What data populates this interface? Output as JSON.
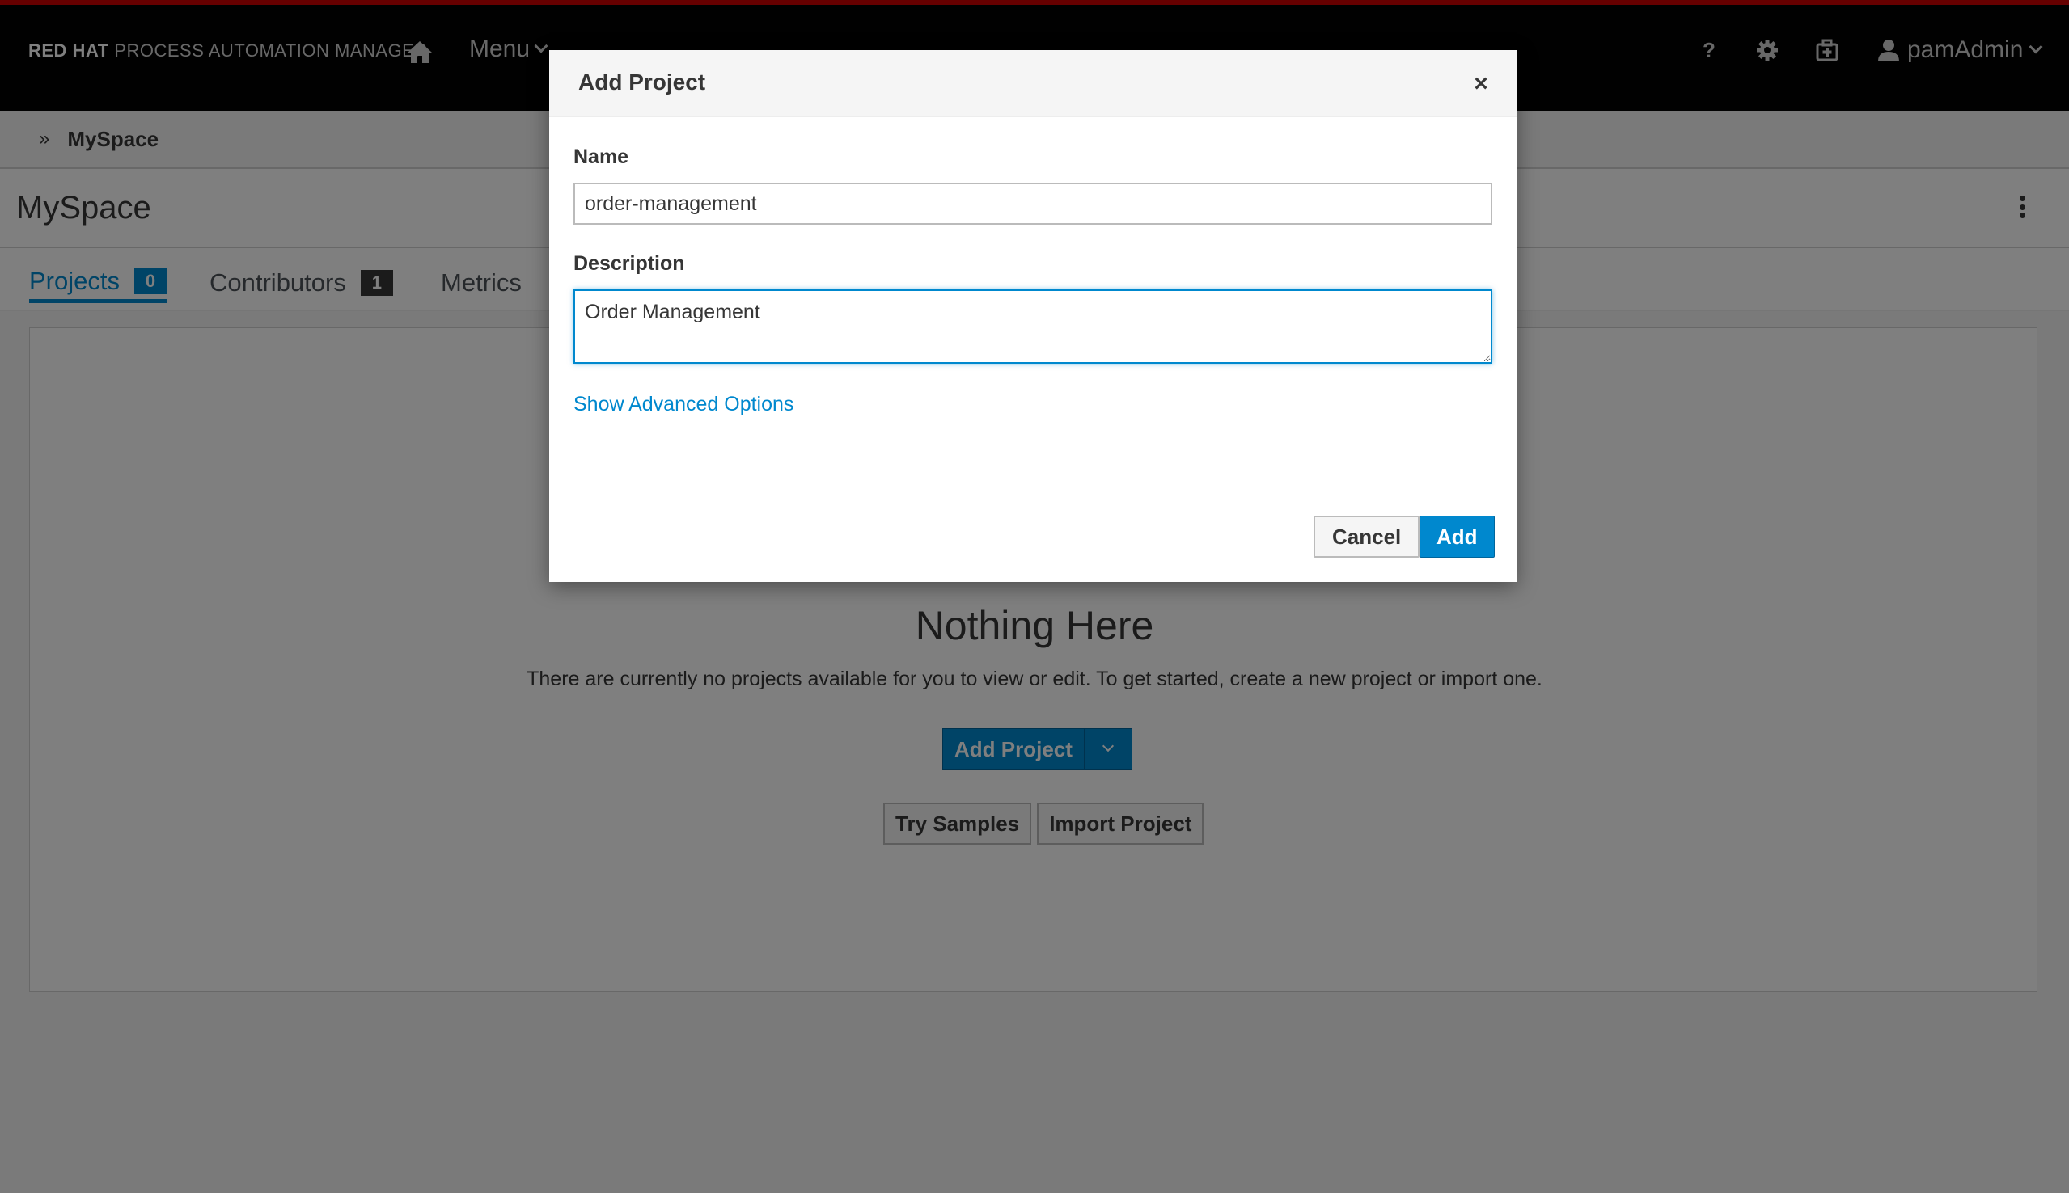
{
  "app": {
    "brand_bold": "RED HAT",
    "brand_rest": "PROCESS AUTOMATION MANAGER"
  },
  "nav": {
    "menu_label": "Menu",
    "help_label": "?",
    "user_label": "pamAdmin"
  },
  "breadcrumb": {
    "chevrons": "»",
    "item": "MySpace"
  },
  "space": {
    "title": "MySpace"
  },
  "tabs": [
    {
      "label": "Projects",
      "count": "0",
      "active": true
    },
    {
      "label": "Contributors",
      "count": "1",
      "active": false
    },
    {
      "label": "Metrics",
      "active": false
    }
  ],
  "empty_state": {
    "title": "Nothing Here",
    "text": "There are currently no projects available for you to view or edit. To get started, create a new project or import one.",
    "add_project_label": "Add Project",
    "try_samples_label": "Try Samples",
    "import_project_label": "Import Project"
  },
  "modal": {
    "title": "Add Project",
    "close_label": "×",
    "name_label": "Name",
    "name_value": "order-management",
    "description_label": "Description",
    "description_value": "Order Management",
    "advanced_link": "Show Advanced Options",
    "cancel_label": "Cancel",
    "add_label": "Add"
  },
  "colors": {
    "accent": "#0088ce",
    "topbar": "#030303",
    "brand_red": "#cc0000"
  },
  "icons": [
    "home-icon",
    "chevron-down-icon",
    "help-icon",
    "gear-icon",
    "case-management-icon",
    "user-icon",
    "kebab-icon",
    "close-icon",
    "resize-handle-icon"
  ]
}
